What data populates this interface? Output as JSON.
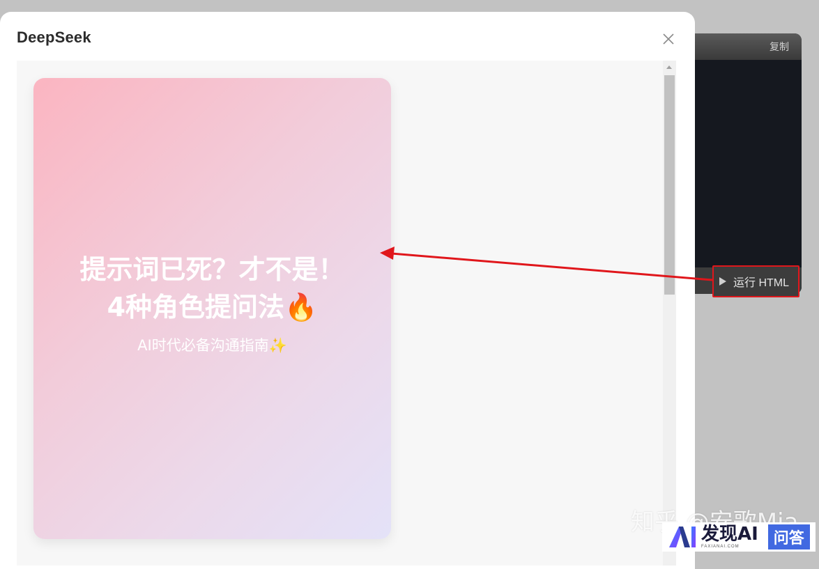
{
  "modal": {
    "title": "DeepSeek"
  },
  "card": {
    "title_line1": "提示词已死？才不是！",
    "title_line2": "4种角色提问法🔥",
    "subtitle": "AI时代必备沟通指南✨"
  },
  "code_panel": {
    "copy_label": "复制",
    "run_label": "运行 HTML"
  },
  "watermark": {
    "text": "知乎 @安歌Mia",
    "logo_main": "发现AI",
    "logo_sub": "FAXIANAI.COM",
    "logo_badge": "问答"
  },
  "colors": {
    "annotation_red": "#e0161b",
    "card_gradient_start": "#fbb5c1",
    "card_gradient_end": "#e4e2f8"
  },
  "icons": {
    "close": "close-icon",
    "play": "play-icon",
    "scroll_up": "scroll-up-arrow-icon"
  }
}
